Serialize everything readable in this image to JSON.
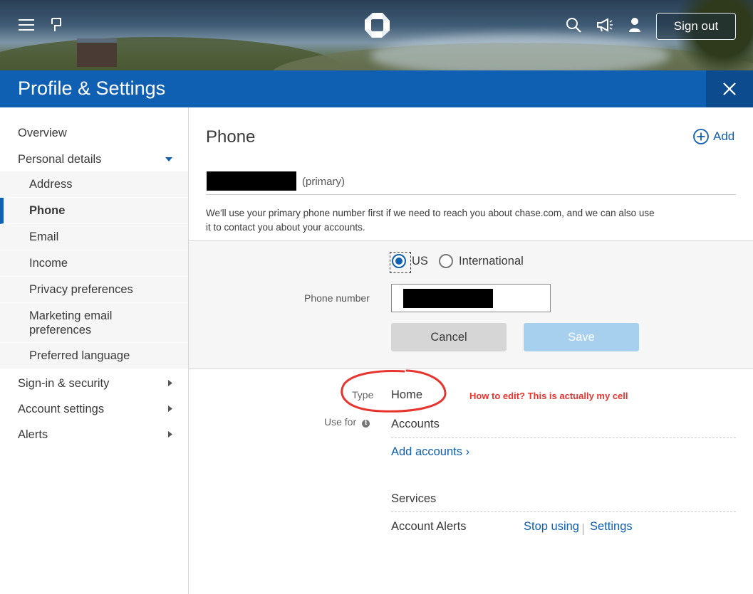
{
  "topbar": {
    "menu_icon": "hamburger-menu-icon",
    "flag_icon": "flag-icon",
    "logo": "chase-octagon-logo",
    "search_icon": "search-icon",
    "megaphone_icon": "megaphone-icon",
    "user_icon": "user-icon",
    "sign_out_label": "Sign out"
  },
  "header": {
    "title": "Profile & Settings",
    "close_icon": "close-icon"
  },
  "sidebar": {
    "overview": "Overview",
    "personal_details": "Personal details",
    "sub_items": [
      {
        "label": "Address"
      },
      {
        "label": "Phone",
        "active": true
      },
      {
        "label": "Email"
      },
      {
        "label": "Income"
      },
      {
        "label": "Privacy preferences"
      },
      {
        "label": "Marketing email preferences"
      },
      {
        "label": "Preferred language"
      }
    ],
    "signin_security": "Sign-in & security",
    "account_settings": "Account settings",
    "alerts": "Alerts"
  },
  "main": {
    "title": "Phone",
    "add_label": "Add",
    "primary_label": "(primary)",
    "note": "We'll use your primary phone number first if we need to reach you about chase.com, and we can also use it to contact you about your accounts.",
    "radio_us": "US",
    "radio_international": "International",
    "selected_region": "US",
    "phone_number_label": "Phone number",
    "cancel_label": "Cancel",
    "save_label": "Save",
    "type_label": "Type",
    "type_value": "Home",
    "use_for_label": "Use for",
    "accounts_heading": "Accounts",
    "add_accounts_link": "Add accounts ›",
    "services_heading": "Services",
    "service_name": "Account Alerts",
    "stop_using_link": "Stop using",
    "settings_link": "Settings"
  },
  "annotation": {
    "note": "How to edit? This is actually my cell",
    "color": "#e8342e"
  },
  "colors": {
    "brand_blue": "#0f5fb3",
    "header_close_bg": "#0c4b8e",
    "save_disabled": "#a6d0ee"
  }
}
